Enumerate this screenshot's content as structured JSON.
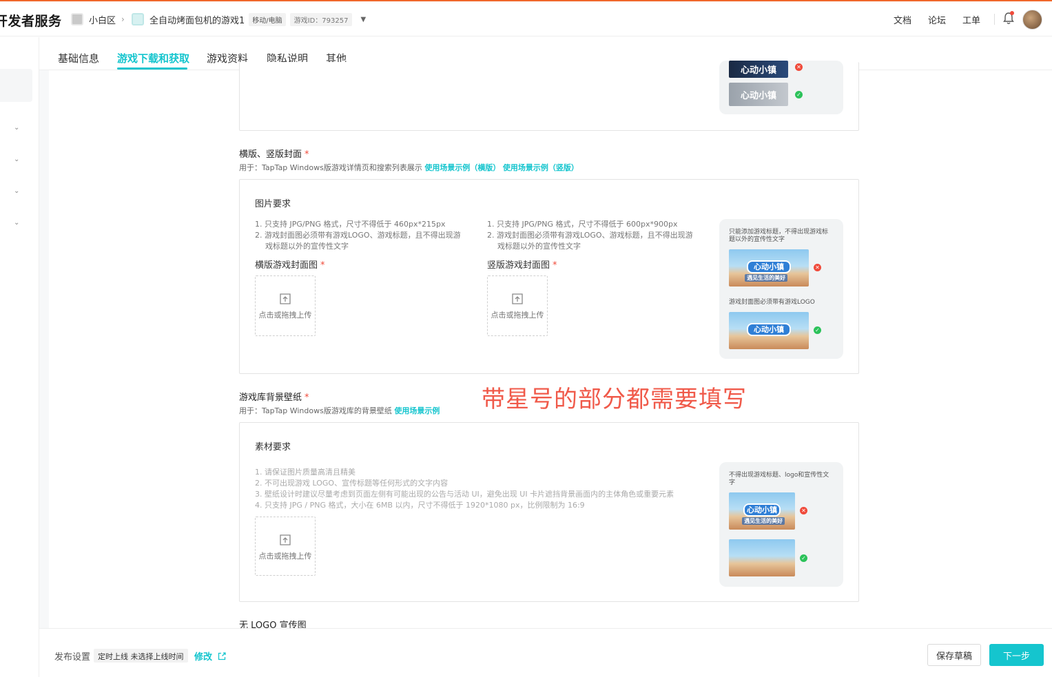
{
  "header": {
    "brand": "开发者服务",
    "crumb1": "小白区",
    "crumb2": "全自动烤面包机的游戏1",
    "platform_tag": "移动/电脑",
    "game_id": "游戏ID：793257",
    "links": [
      "文档",
      "论坛",
      "工单"
    ]
  },
  "tabs": [
    "基础信息",
    "游戏下载和获取",
    "游戏资料",
    "隐私说明",
    "其他"
  ],
  "top_example": {
    "logo_text": "心动小镇"
  },
  "cover": {
    "title": "横版、竖版封面",
    "desc_prefix": "用于：TapTap Windows版游戏详情页和搜索列表展示",
    "link_h": "使用场景示例（横版）",
    "link_v": "使用场景示例（竖版）",
    "req_title": "图片要求",
    "h_req": [
      "1. 只支持 JPG/PNG 格式，尺寸不得低于 460px*215px",
      "2. 游戏封面图必须带有游戏LOGO、游戏标题，且不得出现游",
      "戏标题以外的宣传性文字"
    ],
    "v_req": [
      "1. 只支持 JPG/PNG 格式，尺寸不得低于 600px*900px",
      "2. 游戏封面图必须带有游戏LOGO、游戏标题，且不得出现游",
      "戏标题以外的宣传性文字"
    ],
    "h_label": "横版游戏封面图",
    "v_label": "竖版游戏封面图",
    "upload_text": "点击或拖拽上传",
    "ex_caption1": "只能添加游戏标题，不得出现游戏标题以外的宣传性文字",
    "ex_caption2": "游戏封面图必须带有游戏LOGO",
    "thumb_logo": "心动小镇",
    "thumb_sub": "遇见生活的美好"
  },
  "wallpaper": {
    "title": "游戏库背景壁纸",
    "desc_prefix": "用于：TapTap Windows版游戏库的背景壁纸",
    "link": "使用场景示例",
    "req_title": "素材要求",
    "req": [
      "1. 请保证图片质量高清且精美",
      "2. 不可出现游戏 LOGO、宣传标题等任何形式的文字内容",
      "3. 壁纸设计时建议尽量考虑到页面左侧有可能出现的公告与活动 UI，避免出现 UI 卡片遮挡背景画面内的主体角色或重要元素",
      "4. 只支持 JPG / PNG 格式，大小在 6MB 以内，尺寸不得低于 1920*1080 px，比例限制为 16:9"
    ],
    "upload_text": "点击或拖拽上传",
    "ex_caption": "不得出现游戏标题、logo和宣传性文字",
    "thumb_logo": "心动小镇",
    "thumb_sub": "遇见生活的美好"
  },
  "next_section_title": "无 LOGO 宣传图",
  "annotation": "带星号的部分都需要填写",
  "footer": {
    "label": "发布设置",
    "tag": "定时上线   未选择上线时间",
    "edit": "修改",
    "draft": "保存草稿",
    "next": "下一步"
  },
  "colors": {
    "accent": "#15c5ce",
    "required": "#f04a3a",
    "topline": "#f0672b"
  }
}
